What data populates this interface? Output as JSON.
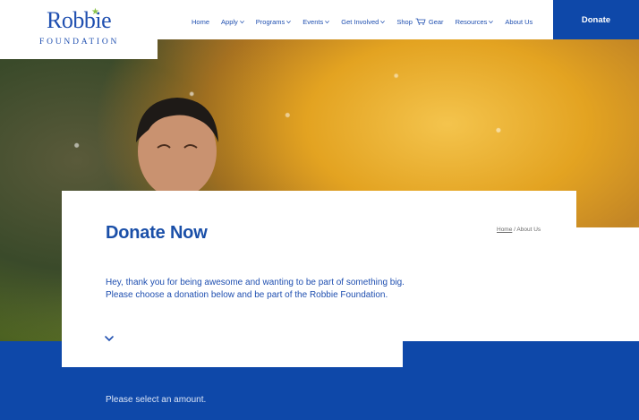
{
  "logo": {
    "word": "Robbie",
    "sub": "FOUNDATION"
  },
  "nav": {
    "items": [
      {
        "label": "Home",
        "dropdown": false
      },
      {
        "label": "Apply",
        "dropdown": true
      },
      {
        "label": "Programs",
        "dropdown": true
      },
      {
        "label": "Events",
        "dropdown": true
      },
      {
        "label": "Get Involved",
        "dropdown": true
      },
      {
        "label": "Shop",
        "icon": "shopping-cart-icon",
        "label2": "Gear",
        "dropdown": false
      },
      {
        "label": "Resources",
        "dropdown": true
      },
      {
        "label": "About Us",
        "dropdown": false
      }
    ]
  },
  "donate_button": "Donate",
  "breadcrumb": {
    "home": "Home",
    "separator": "/",
    "current": "About Us"
  },
  "page": {
    "title": "Donate Now",
    "intro": "Hey, thank you for being awesome and wanting to be part of something big. Please choose a donation below and be part of the Robbie Foundation.",
    "select_prompt": "Please select an amount."
  },
  "colors": {
    "brand_blue": "#0e48a9",
    "text_blue": "#1f4fb0",
    "star_green": "#8bc34a"
  }
}
